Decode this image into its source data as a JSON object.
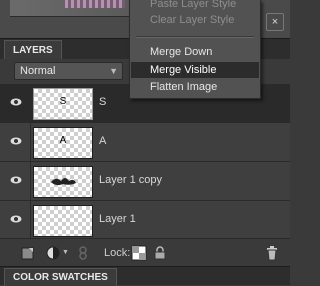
{
  "panel": {
    "tab_label": "LAYERS",
    "blend_mode": "Normal",
    "lock_label": "Lock:",
    "swatches_tab_label": "COLOR SWATCHES",
    "close_glyph": "×"
  },
  "layers": [
    {
      "name": "S",
      "thumb_text": "S",
      "selected": true
    },
    {
      "name": "A",
      "thumb_text": "A",
      "selected": false
    },
    {
      "name": "Layer 1 copy",
      "thumb_text": "",
      "selected": false
    },
    {
      "name": "Layer 1",
      "thumb_text": "",
      "selected": false
    }
  ],
  "context_menu": {
    "items": [
      {
        "label": "Paste Layer Style",
        "state": "disabled"
      },
      {
        "label": "Clear Layer Style",
        "state": "disabled"
      },
      {
        "label": "Merge Down",
        "state": "enabled"
      },
      {
        "label": "Merge Visible",
        "state": "hover"
      },
      {
        "label": "Flatten Image",
        "state": "enabled"
      }
    ]
  },
  "colors": {
    "panel_bg": "#3a3a3a",
    "menu_bg": "#525252",
    "menu_hover": "#2c2c2c"
  },
  "icons": {
    "new_layer": "new-layer-icon",
    "adjustment": "adjustment-layer-icon",
    "link": "link-icon",
    "lock_transparent": "lock-transparency-icon",
    "lock_all": "lock-icon",
    "trash": "trash-icon",
    "eye": "eye-icon"
  }
}
